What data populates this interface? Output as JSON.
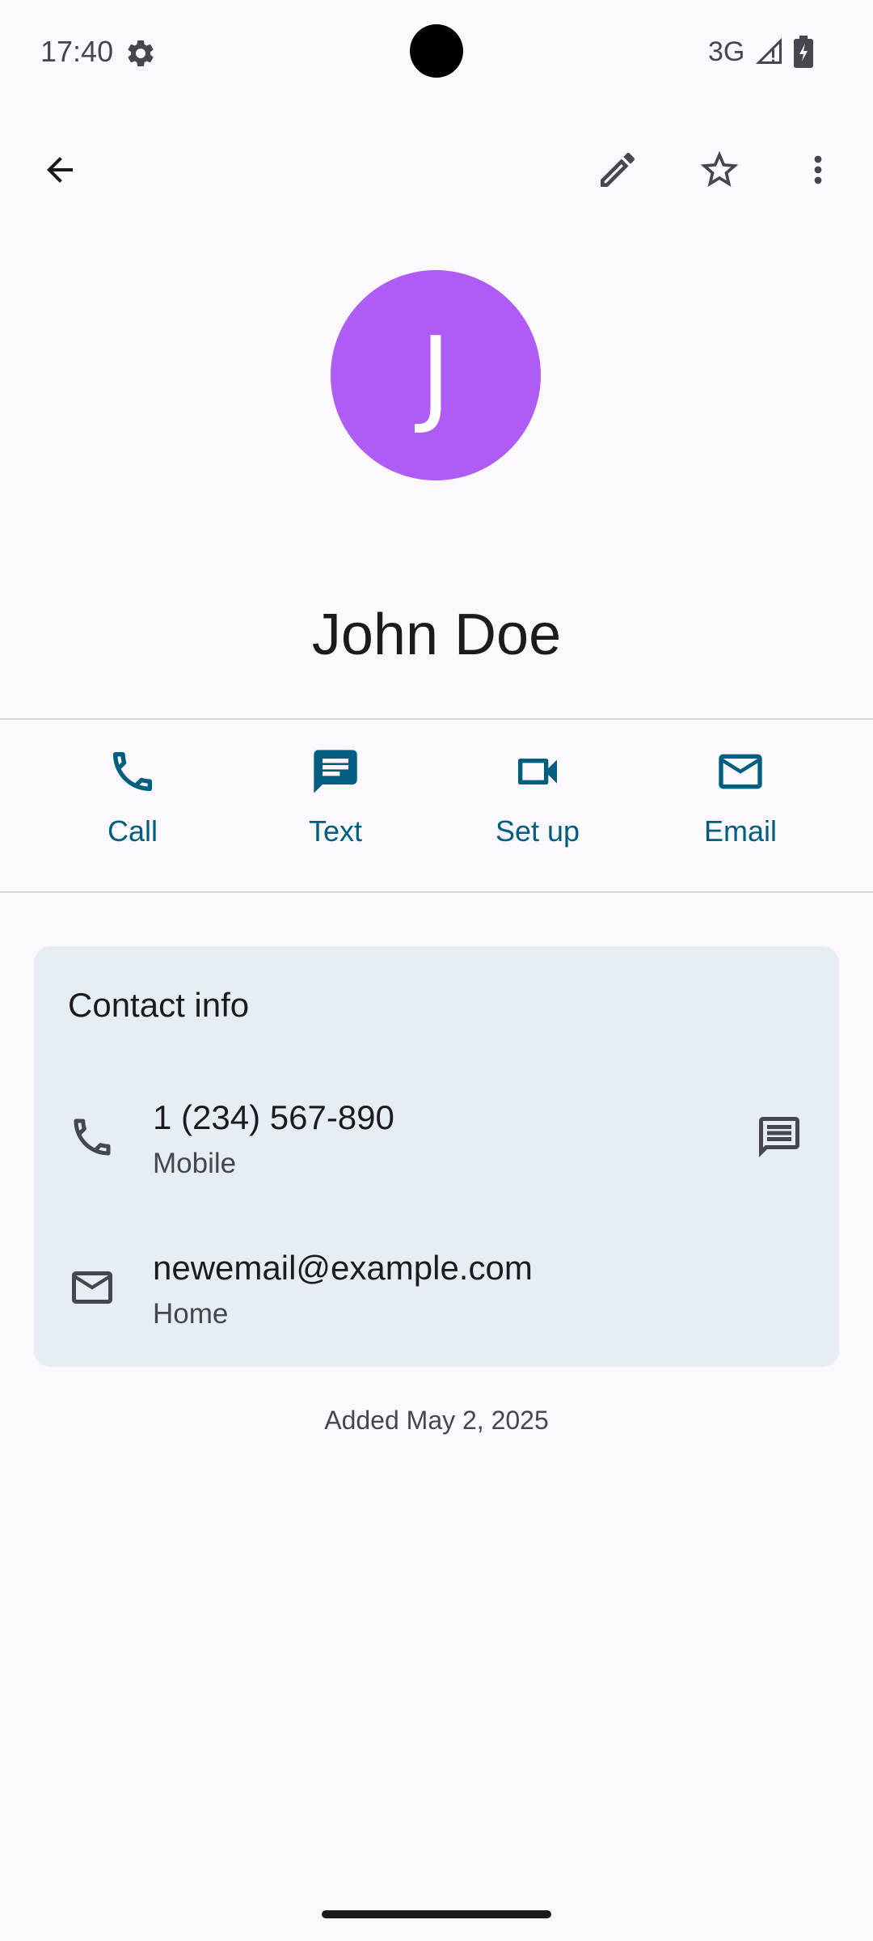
{
  "status_bar": {
    "time": "17:40",
    "network": "3G",
    "icons": [
      "settings-gear-icon",
      "signal-icon",
      "battery-charging-icon"
    ]
  },
  "app_bar": {
    "icons": [
      "back-arrow-icon",
      "edit-pencil-icon",
      "star-outline-icon",
      "more-vert-icon"
    ]
  },
  "contact": {
    "initial": "J",
    "name": "John Doe",
    "avatar_color": "#AF5CF7"
  },
  "actions": [
    {
      "label": "Call",
      "icon": "phone-icon"
    },
    {
      "label": "Text",
      "icon": "message-icon"
    },
    {
      "label": "Set up",
      "icon": "video-camera-icon"
    },
    {
      "label": "Email",
      "icon": "mail-icon"
    }
  ],
  "contact_info": {
    "title": "Contact info",
    "phone": {
      "value": "1 (234) 567-890",
      "type": "Mobile"
    },
    "email": {
      "value": "newemail@example.com",
      "type": "Home"
    }
  },
  "added_text": "Added May 2, 2025",
  "colors": {
    "background": "#FBF9FD",
    "accent": "#005E80",
    "card": "#E6EDF3",
    "icon": "#44474E"
  }
}
